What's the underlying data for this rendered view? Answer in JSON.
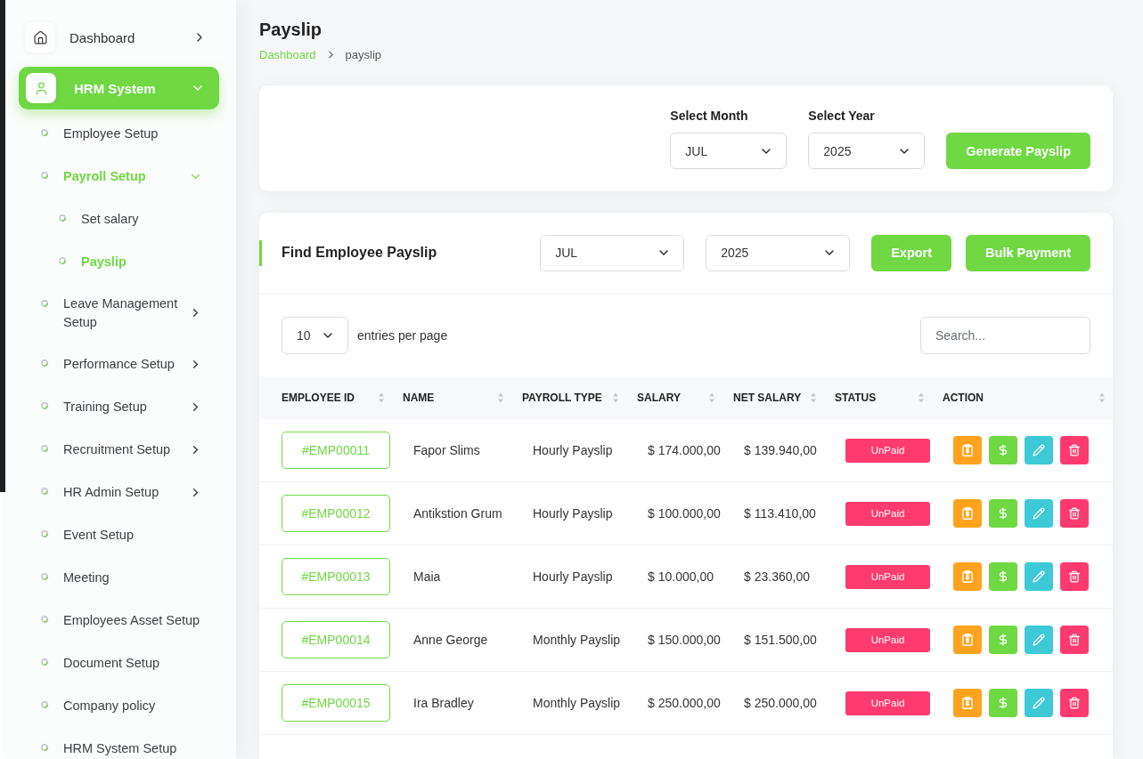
{
  "sidebar": {
    "items": [
      {
        "label": "Dashboard",
        "kind": "group",
        "selected": false,
        "expanded": false
      },
      {
        "label": "HRM System",
        "kind": "group",
        "selected": true,
        "expanded": true,
        "children": [
          {
            "label": "Employee Setup",
            "kind": "link",
            "selected": false
          },
          {
            "label": "Payroll Setup",
            "kind": "group",
            "selected": true,
            "expanded": true,
            "children": [
              {
                "label": "Set salary",
                "selected": false
              },
              {
                "label": "Payslip",
                "selected": true
              }
            ]
          },
          {
            "label": "Leave Management Setup",
            "kind": "group",
            "selected": false,
            "expanded": false
          },
          {
            "label": "Performance Setup",
            "kind": "group",
            "selected": false,
            "expanded": false
          },
          {
            "label": "Training Setup",
            "kind": "group",
            "selected": false,
            "expanded": false
          },
          {
            "label": "Recruitment Setup",
            "kind": "group",
            "selected": false,
            "expanded": false
          },
          {
            "label": "HR Admin Setup",
            "kind": "group",
            "selected": false,
            "expanded": false
          },
          {
            "label": "Event Setup",
            "kind": "link",
            "selected": false
          },
          {
            "label": "Meeting",
            "kind": "link",
            "selected": false
          },
          {
            "label": "Employees Asset Setup",
            "kind": "link",
            "selected": false
          },
          {
            "label": "Document Setup",
            "kind": "link",
            "selected": false
          },
          {
            "label": "Company policy",
            "kind": "link",
            "selected": false
          },
          {
            "label": "HRM System Setup",
            "kind": "link",
            "selected": false
          }
        ]
      }
    ]
  },
  "page": {
    "title": "Payslip",
    "breadcrumb": [
      {
        "label": "Dashboard",
        "kind": "link"
      },
      {
        "label": "payslip",
        "kind": "current"
      }
    ]
  },
  "generate_card": {
    "month": {
      "label": "Select Month",
      "value": "JUL"
    },
    "year": {
      "label": "Select Year",
      "value": "2025"
    },
    "button": "Generate Payslip"
  },
  "find_card": {
    "title": "Find Employee Payslip",
    "month": "JUL",
    "year": "2025",
    "buttons": [
      "Export",
      "Bulk Payment"
    ]
  },
  "table_controls": {
    "page_size": "10",
    "page_size_label": "entries per page",
    "search": {
      "placeholder": "Search..."
    }
  },
  "table": {
    "columns": [
      "EMPLOYEE ID",
      "NAME",
      "PAYROLL TYPE",
      "SALARY",
      "NET SALARY",
      "STATUS",
      "ACTION"
    ],
    "rows": [
      {
        "employee_id": "#EMP00011",
        "name": "Fapor Slims",
        "payroll_type": "Hourly Payslip",
        "salary": "$ 174.000,00",
        "net_salary": "$ 139.940,00",
        "status": "UnPaid"
      },
      {
        "employee_id": "#EMP00012",
        "name": "Antikstion Grum",
        "payroll_type": "Hourly Payslip",
        "salary": "$ 100.000,00",
        "net_salary": "$ 113.410,00",
        "status": "UnPaid"
      },
      {
        "employee_id": "#EMP00013",
        "name": "Maia",
        "payroll_type": "Hourly Payslip",
        "salary": "$ 10.000,00",
        "net_salary": "$ 23.360,00",
        "status": "UnPaid"
      },
      {
        "employee_id": "#EMP00014",
        "name": "Anne George",
        "payroll_type": "Monthly Payslip",
        "salary": "$ 150.000,00",
        "net_salary": "$ 151.500,00",
        "status": "UnPaid"
      },
      {
        "employee_id": "#EMP00015",
        "name": "Ira Bradley",
        "payroll_type": "Monthly Payslip",
        "salary": "$ 250.000,00",
        "net_salary": "$ 250.000,00",
        "status": "UnPaid"
      }
    ]
  }
}
